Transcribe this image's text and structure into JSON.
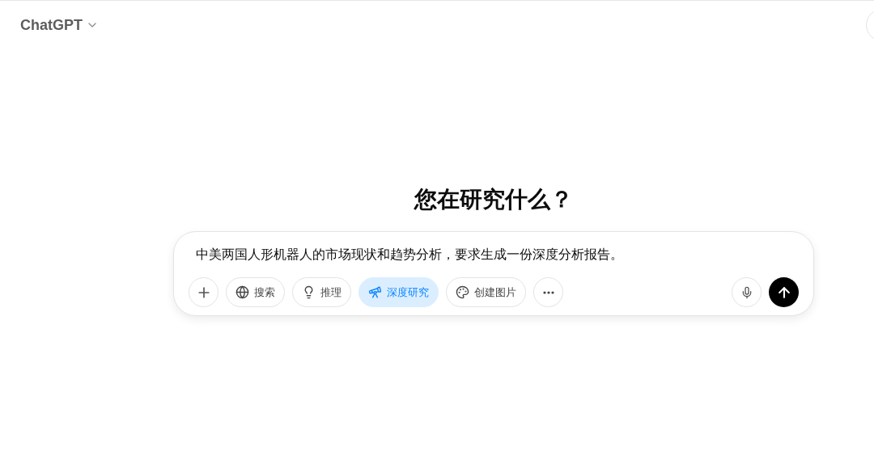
{
  "header": {
    "model": "ChatGPT"
  },
  "heading": "您在研究什么？",
  "composer": {
    "value": "中美两国人形机器人的市场现状和趋势分析，要求生成一份深度分析报告。",
    "tools": [
      {
        "kind": "search",
        "label": "搜索",
        "selected": false
      },
      {
        "kind": "reason",
        "label": "推理",
        "selected": false
      },
      {
        "kind": "research",
        "label": "深度研究",
        "selected": true
      },
      {
        "kind": "image",
        "label": "创建图片",
        "selected": false
      }
    ]
  }
}
